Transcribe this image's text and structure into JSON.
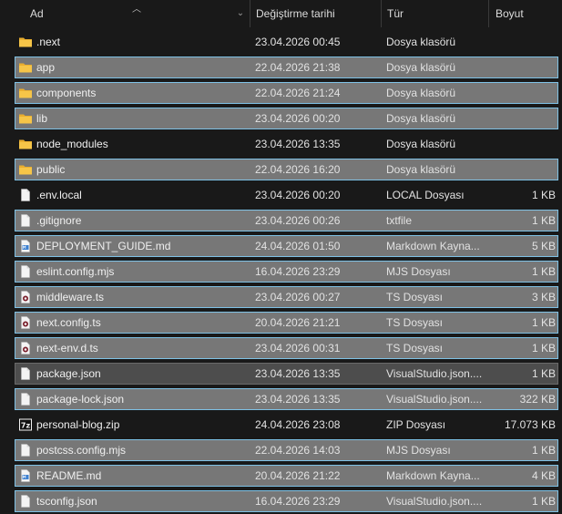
{
  "header": {
    "name": "Ad",
    "date": "Değiştirme tarihi",
    "type": "Tür",
    "size": "Boyut"
  },
  "files": [
    {
      "name": ".next",
      "date": "23.04.2026 00:45",
      "type": "Dosya klasörü",
      "size": "",
      "icon": "folder-icon",
      "state": "normal"
    },
    {
      "name": "app",
      "date": "22.04.2026 21:38",
      "type": "Dosya klasörü",
      "size": "",
      "icon": "folder-icon",
      "state": "selected"
    },
    {
      "name": "components",
      "date": "22.04.2026 21:24",
      "type": "Dosya klasörü",
      "size": "",
      "icon": "folder-icon",
      "state": "selected"
    },
    {
      "name": "lib",
      "date": "23.04.2026 00:20",
      "type": "Dosya klasörü",
      "size": "",
      "icon": "folder-icon",
      "state": "selected"
    },
    {
      "name": "node_modules",
      "date": "23.04.2026 13:35",
      "type": "Dosya klasörü",
      "size": "",
      "icon": "folder-icon",
      "state": "normal"
    },
    {
      "name": "public",
      "date": "22.04.2026 16:20",
      "type": "Dosya klasörü",
      "size": "",
      "icon": "folder-icon",
      "state": "selected"
    },
    {
      "name": ".env.local",
      "date": "23.04.2026 00:20",
      "type": "LOCAL Dosyası",
      "size": "1 KB",
      "icon": "file-icon",
      "state": "normal"
    },
    {
      "name": ".gitignore",
      "date": "23.04.2026 00:26",
      "type": "txtfile",
      "size": "1 KB",
      "icon": "file-icon",
      "state": "selected"
    },
    {
      "name": "DEPLOYMENT_GUIDE.md",
      "date": "24.04.2026 01:50",
      "type": "Markdown Kayna...",
      "size": "5 KB",
      "icon": "markdown-file-icon",
      "state": "selected"
    },
    {
      "name": "eslint.config.mjs",
      "date": "16.04.2026 23:29",
      "type": "MJS Dosyası",
      "size": "1 KB",
      "icon": "file-icon",
      "state": "selected"
    },
    {
      "name": "middleware.ts",
      "date": "23.04.2026 00:27",
      "type": "TS Dosyası",
      "size": "3 KB",
      "icon": "ts-file-icon",
      "state": "selected"
    },
    {
      "name": "next.config.ts",
      "date": "20.04.2026 21:21",
      "type": "TS Dosyası",
      "size": "1 KB",
      "icon": "ts-file-icon",
      "state": "selected"
    },
    {
      "name": "next-env.d.ts",
      "date": "23.04.2026 00:31",
      "type": "TS Dosyası",
      "size": "1 KB",
      "icon": "ts-file-icon",
      "state": "selected"
    },
    {
      "name": "package.json",
      "date": "23.04.2026 13:35",
      "type": "VisualStudio.json....",
      "size": "1 KB",
      "icon": "file-icon",
      "state": "hover"
    },
    {
      "name": "package-lock.json",
      "date": "23.04.2026 13:35",
      "type": "VisualStudio.json....",
      "size": "322 KB",
      "icon": "file-icon",
      "state": "selected"
    },
    {
      "name": "personal-blog.zip",
      "date": "24.04.2026 23:08",
      "type": "ZIP Dosyası",
      "size": "17.073 KB",
      "icon": "zip-archive-icon",
      "state": "normal"
    },
    {
      "name": "postcss.config.mjs",
      "date": "22.04.2026 14:03",
      "type": "MJS Dosyası",
      "size": "1 KB",
      "icon": "file-icon",
      "state": "selected"
    },
    {
      "name": "README.md",
      "date": "20.04.2026 21:22",
      "type": "Markdown Kayna...",
      "size": "4 KB",
      "icon": "markdown-file-icon",
      "state": "selected"
    },
    {
      "name": "tsconfig.json",
      "date": "16.04.2026 23:29",
      "type": "VisualStudio.json....",
      "size": "1 KB",
      "icon": "file-icon",
      "state": "selected"
    }
  ],
  "colors": {
    "background": "#191919",
    "selection": "#777777",
    "selection_border": "#7fc2e6",
    "folder": "#f6c548"
  }
}
